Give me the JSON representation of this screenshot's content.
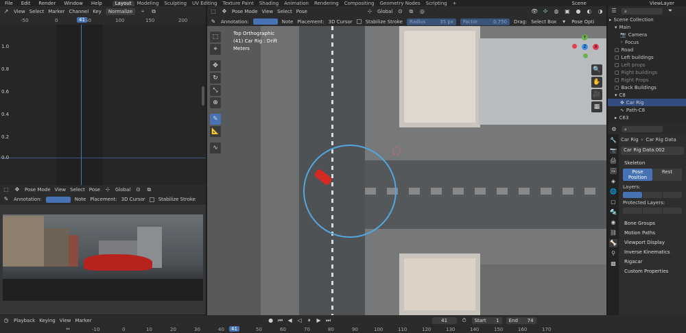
{
  "top_menu": {
    "items": [
      "File",
      "Edit",
      "Render",
      "Window",
      "Help"
    ],
    "workspaces": [
      "Layout",
      "Modeling",
      "Sculpting",
      "UV Editing",
      "Texture Paint",
      "Shading",
      "Animation",
      "Rendering",
      "Compositing",
      "Geometry Nodes",
      "Scripting"
    ],
    "active_workspace": "Layout",
    "plus": "+",
    "scene": "Scene",
    "view_layer": "ViewLayer"
  },
  "graph_editor": {
    "menus": [
      "View",
      "Select",
      "Marker",
      "Channel",
      "Key"
    ],
    "normalize": "Normalize",
    "ruler": [
      "-50",
      "0",
      "50",
      "100",
      "150",
      "200"
    ],
    "current_frame": "41",
    "y_labels": [
      "1.0",
      "0.8",
      "0.6",
      "0.4",
      "0.2",
      "0.0"
    ]
  },
  "viewport": {
    "mode": "Pose Mode",
    "menus": [
      "View",
      "Select",
      "Pose"
    ],
    "orientation": "Global",
    "overlay_title": "Top Orthographic",
    "overlay_object": "(41) Car Rig : Drift",
    "overlay_units": "Meters",
    "annotation_label": "Annotation:",
    "note": "Note",
    "placement_label": "Placement:",
    "placement": "3D Cursor",
    "stabilize": "Stabilize Stroke",
    "radius_label": "Radius",
    "radius_val": "35 px",
    "factor_label": "Factor",
    "factor_val": "0.750",
    "drag_label": "Drag:",
    "drag_val": "Select Box",
    "pose_opt": "Pose Opti",
    "axis": {
      "x": "X",
      "y": "Y",
      "z": "Z"
    }
  },
  "camera_view": {
    "mode": "Pose Mode",
    "menus": [
      "View",
      "Select",
      "Pose"
    ],
    "orientation": "Global",
    "annotation_label": "Annotation:",
    "note": "Note",
    "placement_label": "Placement:",
    "placement": "3D Cursor",
    "stabilize": "Stabilize Stroke"
  },
  "timeline": {
    "menus": [
      "Playback",
      "Keying",
      "View",
      "Marker"
    ],
    "current": "41",
    "start_label": "Start",
    "start": "1",
    "end_label": "End",
    "end": "74",
    "ruler": [
      "-10",
      "0",
      "10",
      "20",
      "30",
      "40",
      "41",
      "50",
      "60",
      "70",
      "80",
      "90",
      "100",
      "110",
      "120",
      "130",
      "140",
      "150",
      "160",
      "170"
    ]
  },
  "outliner": {
    "items": [
      {
        "label": "Scene Collection",
        "indent": 0
      },
      {
        "label": "Main",
        "indent": 1
      },
      {
        "label": "Camera",
        "indent": 2
      },
      {
        "label": "Focus",
        "indent": 2
      },
      {
        "label": "Road",
        "indent": 1
      },
      {
        "label": "Left buildings",
        "indent": 1
      },
      {
        "label": "Left props",
        "indent": 1
      },
      {
        "label": "Right buildings",
        "indent": 1
      },
      {
        "label": "Right Props",
        "indent": 1
      },
      {
        "label": "Back Buildings",
        "indent": 1
      },
      {
        "label": "C8",
        "indent": 1
      },
      {
        "label": "Car Rig",
        "indent": 2
      },
      {
        "label": "Path-C8",
        "indent": 2
      },
      {
        "label": "C63",
        "indent": 1
      }
    ],
    "selected": "Car Rig"
  },
  "properties": {
    "breadcrumb_obj": "Car Rig",
    "breadcrumb_data": "Car Rig Data",
    "datablock": "Car Rig Data.002",
    "skeleton": "Skeleton",
    "pose_position": "Pose Position",
    "rest": "Rest",
    "layers": "Layers:",
    "protected_layers": "Protected Layers:",
    "panels": [
      "Bone Groups",
      "Motion Paths",
      "Viewport Display",
      "Inverse Kinematics",
      "Rigacar",
      "Custom Properties"
    ]
  }
}
